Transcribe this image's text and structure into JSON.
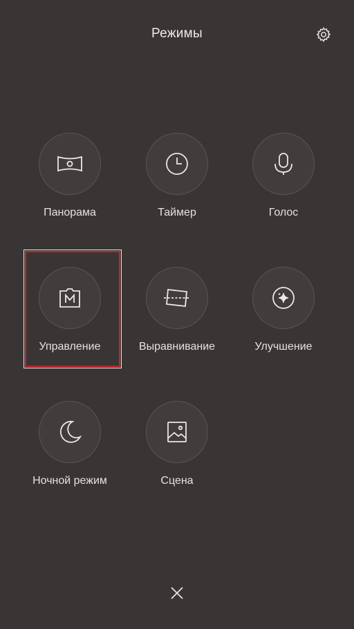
{
  "header": {
    "title": "Режимы",
    "settings_icon": "gear-icon"
  },
  "modes": [
    {
      "label": "Панорама",
      "icon": "panorama-icon"
    },
    {
      "label": "Таймер",
      "icon": "clock-icon"
    },
    {
      "label": "Голос",
      "icon": "microphone-icon"
    },
    {
      "label": "Управление",
      "icon": "manual-m-icon",
      "highlighted": true
    },
    {
      "label": "Выравнивание",
      "icon": "straighten-icon"
    },
    {
      "label": "Улучшение",
      "icon": "sparkle-icon"
    },
    {
      "label": "Ночной режим",
      "icon": "moon-icon"
    },
    {
      "label": "Сцена",
      "icon": "image-icon"
    }
  ],
  "footer": {
    "close_icon": "close-icon"
  },
  "colors": {
    "background": "#3a3535",
    "highlight": "#c2262c"
  }
}
